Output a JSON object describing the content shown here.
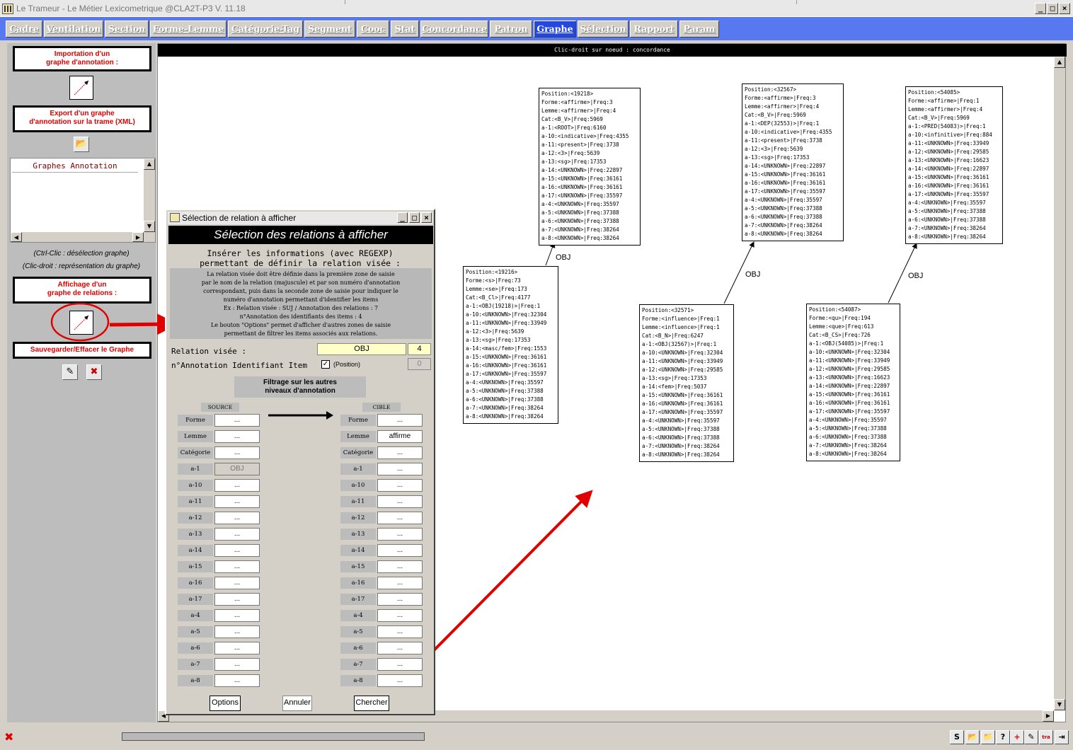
{
  "window": {
    "title": "Le Trameur - Le Métier Lexicometrique @CLA2T-P3 V. 11.18"
  },
  "tabs": [
    "Cadre",
    "Ventilation",
    "Section",
    "Forme-Lemme",
    "Catégorie-Tag",
    "Segment",
    "Cooc",
    "Stat",
    "Concordance",
    "Patron",
    "Graphe",
    "Sélection",
    "Rapport",
    "Param"
  ],
  "active_tab": "Graphe",
  "left": {
    "import_label_1": "Importation d'un",
    "import_label_2": "graphe d'annotation :",
    "export_label_1": "Export d'un graphe",
    "export_label_2": "d'annotation sur la trame (XML)",
    "list_header": "Graphes Annotation",
    "note1": "(Ctrl-Clic : désélection graphe)",
    "note2": "(Clic-droit : représentation du graphe)",
    "display_label_1": "Affichage d'un",
    "display_label_2": "graphe de relations :",
    "save_label": "Sauvegarder/Effacer le Graphe"
  },
  "canvas": {
    "header": "Clic-droit sur noeud : concordance",
    "edge_label": "OBJ",
    "nodes": [
      {
        "lines": [
          "Position:<19218>",
          "Forme:<affirme>|Freq:3",
          "Lemme:<affirmer>|Freq:4",
          "Cat:<B_V>|Freq:5969",
          "a-1:<ROOT>|Freq:6160",
          "a-10:<indicative>|Freq:4355",
          "a-11:<present>|Freq:3738",
          "a-12:<3>|Freq:5639",
          "a-13:<sg>|Freq:17353",
          "a-14:<UNKNOWN>|Freq:22897",
          "a-15:<UNKNOWN>|Freq:36161",
          "a-16:<UNKNOWN>|Freq:36161",
          "a-17:<UNKNOWN>|Freq:35597",
          "a-4:<UNKNOWN>|Freq:35597",
          "a-5:<UNKNOWN>|Freq:37388",
          "a-6:<UNKNOWN>|Freq:37388",
          "a-7:<UNKNOWN>|Freq:38264",
          "a-8:<UNKNOWN>|Freq:38264"
        ]
      },
      {
        "lines": [
          "Position:<19216>",
          "Forme:<s>|Freq:73",
          "Lemme:<se>|Freq:173",
          "Cat:<B_Cl>|Freq:4177",
          "a-1:<OBJ(19218)>|Freq:1",
          "a-10:<UNKNOWN>|Freq:32304",
          "a-11:<UNKNOWN>|Freq:33949",
          "a-12:<3>|Freq:5639",
          "a-13:<sg>|Freq:17353",
          "a-14:<masc/fem>|Freq:1553",
          "a-15:<UNKNOWN>|Freq:36161",
          "a-16:<UNKNOWN>|Freq:36161",
          "a-17:<UNKNOWN>|Freq:35597",
          "a-4:<UNKNOWN>|Freq:35597",
          "a-5:<UNKNOWN>|Freq:37388",
          "a-6:<UNKNOWN>|Freq:37388",
          "a-7:<UNKNOWN>|Freq:38264",
          "a-8:<UNKNOWN>|Freq:38264"
        ]
      },
      {
        "lines": [
          "Position:<32567>",
          "Forme:<affirme>|Freq:3",
          "Lemme:<affirmer>|Freq:4",
          "Cat:<B_V>|Freq:5969",
          "a-1:<DEP(32553)>|Freq:1",
          "a-10:<indicative>|Freq:4355",
          "a-11:<present>|Freq:3738",
          "a-12:<3>|Freq:5639",
          "a-13:<sg>|Freq:17353",
          "a-14:<UNKNOWN>|Freq:22897",
          "a-15:<UNKNOWN>|Freq:36161",
          "a-16:<UNKNOWN>|Freq:36161",
          "a-17:<UNKNOWN>|Freq:35597",
          "a-4:<UNKNOWN>|Freq:35597",
          "a-5:<UNKNOWN>|Freq:37388",
          "a-6:<UNKNOWN>|Freq:37388",
          "a-7:<UNKNOWN>|Freq:38264",
          "a-8:<UNKNOWN>|Freq:38264"
        ]
      },
      {
        "lines": [
          "Position:<32571>",
          "Forme:<influence>|Freq:1",
          "Lemme:<influence>|Freq:1",
          "Cat:<B_N>|Freq:6247",
          "a-1:<OBJ(32567)>|Freq:1",
          "a-10:<UNKNOWN>|Freq:32304",
          "a-11:<UNKNOWN>|Freq:33949",
          "a-12:<UNKNOWN>|Freq:29585",
          "a-13:<sg>|Freq:17353",
          "a-14:<fem>|Freq:5037",
          "a-15:<UNKNOWN>|Freq:36161",
          "a-16:<UNKNOWN>|Freq:36161",
          "a-17:<UNKNOWN>|Freq:35597",
          "a-4:<UNKNOWN>|Freq:35597",
          "a-5:<UNKNOWN>|Freq:37388",
          "a-6:<UNKNOWN>|Freq:37388",
          "a-7:<UNKNOWN>|Freq:38264",
          "a-8:<UNKNOWN>|Freq:38264"
        ]
      },
      {
        "lines": [
          "Position:<54085>",
          "Forme:<affirme>|Freq:1",
          "Lemme:<affirmer>|Freq:4",
          "Cat:<B_V>|Freq:5969",
          "a-1:<PRED(54083)>|Freq:1",
          "a-10:<infinitive>|Freq:884",
          "a-11:<UNKNOWN>|Freq:33949",
          "a-12:<UNKNOWN>|Freq:29585",
          "a-13:<UNKNOWN>|Freq:16623",
          "a-14:<UNKNOWN>|Freq:22897",
          "a-15:<UNKNOWN>|Freq:36161",
          "a-16:<UNKNOWN>|Freq:36161",
          "a-17:<UNKNOWN>|Freq:35597",
          "a-4:<UNKNOWN>|Freq:35597",
          "a-5:<UNKNOWN>|Freq:37388",
          "a-6:<UNKNOWN>|Freq:37388",
          "a-7:<UNKNOWN>|Freq:38264",
          "a-8:<UNKNOWN>|Freq:38264"
        ]
      },
      {
        "lines": [
          "Position:<54087>",
          "Forme:<qu>|Freq:194",
          "Lemme:<que>|Freq:613",
          "Cat:<B_CS>|Freq:726",
          "a-1:<OBJ(54085)>|Freq:1",
          "a-10:<UNKNOWN>|Freq:32304",
          "a-11:<UNKNOWN>|Freq:33949",
          "a-12:<UNKNOWN>|Freq:29585",
          "a-13:<UNKNOWN>|Freq:16623",
          "a-14:<UNKNOWN>|Freq:22897",
          "a-15:<UNKNOWN>|Freq:36161",
          "a-16:<UNKNOWN>|Freq:36161",
          "a-17:<UNKNOWN>|Freq:35597",
          "a-4:<UNKNOWN>|Freq:35597",
          "a-5:<UNKNOWN>|Freq:37388",
          "a-6:<UNKNOWN>|Freq:37388",
          "a-7:<UNKNOWN>|Freq:38264",
          "a-8:<UNKNOWN>|Freq:38264"
        ]
      }
    ]
  },
  "dialog": {
    "title": "Sélection de relation à afficher",
    "heading": "Sélection des relations à afficher",
    "instr1": "Insérer les informations (avec REGEXP)",
    "instr2": "permettant de définir la relation visée :",
    "info": [
      "La relation visée doit être définie dans la première zone de saisie",
      "par le nom de la relation (majuscule) et par son numéro d'annotation",
      "correspondant, puis dans la seconde zone de saisie pour indiquer le",
      "numéro d'annotation permettant d'identifier les items",
      "Ex : Relation visée : SUJ / Annotation des relations : 7",
      "n°Annotation des identifiants des items : 4",
      "Le bouton \"Options\" permet d'afficher d'autres zones de saisie",
      "permettant de filtrer les items associés aux relations."
    ],
    "relation_label": "Relation visée :",
    "relation_value": "OBJ",
    "relation_num": "4",
    "item_label": "n°Annotation Identifiant Item",
    "position_label": "(Position)",
    "position_check": "✓",
    "item_num": "0",
    "filter_label_1": "Filtrage sur les autres",
    "filter_label_2": "niveaux d'annotation",
    "source_label": "SOURCE",
    "target_label": "CIBLE",
    "rows": [
      "Forme",
      "Lemme",
      "Catégorie",
      "a-1",
      "a-10",
      "a-11",
      "a-12",
      "a-13",
      "a-14",
      "a-15",
      "a-16",
      "a-17",
      "a-4",
      "a-5",
      "a-6",
      "a-7",
      "a-8"
    ],
    "placeholder": "...",
    "source_a1_value": "OBJ",
    "target_lemme_value": "affirme",
    "options_btn": "Options",
    "cancel_btn": "Annuler",
    "search_btn": "Chercher"
  },
  "colors": {
    "accent_red": "#e00000",
    "tab_blue": "#5878f0",
    "active_tab": "#2646e0",
    "highlight_yellow": "#ffffc8"
  }
}
